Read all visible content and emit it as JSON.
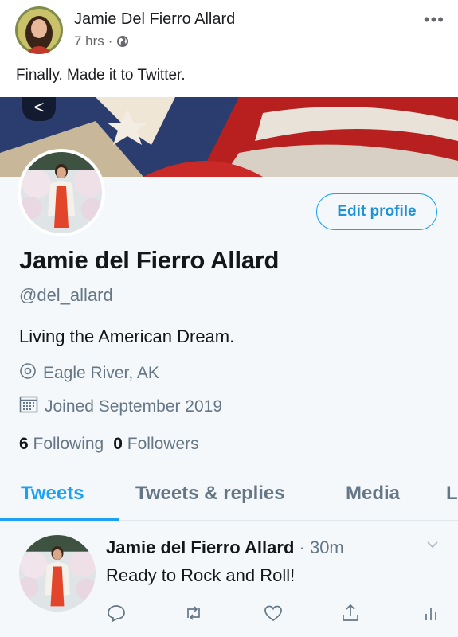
{
  "post": {
    "author": "Jamie Del Fierro Allard",
    "time": "7 hrs",
    "separator": "·",
    "text": "Finally. Made it to Twitter.",
    "more": "•••"
  },
  "twitter": {
    "back": "<",
    "edit_profile": "Edit profile",
    "name": "Jamie del Fierro Allard",
    "handle": "@del_allard",
    "bio": "Living the American Dream.",
    "location": "Eagle River, AK",
    "joined": "Joined September 2019",
    "following_count": "6",
    "following_label": "Following",
    "followers_count": "0",
    "followers_label": "Followers",
    "tabs": [
      {
        "label": "Tweets"
      },
      {
        "label": "Tweets & replies"
      },
      {
        "label": "Media"
      },
      {
        "label": "L"
      }
    ],
    "tweet": {
      "name": "Jamie del Fierro Allard",
      "time": "· 30m",
      "text": "Ready to Rock and Roll!"
    }
  },
  "colors": {
    "twitter_blue": "#1da1f2",
    "secondary_text": "#657786",
    "background": "#f5f8fa"
  },
  "icons": [
    "globe-icon",
    "more-icon",
    "location-pin-icon",
    "calendar-icon",
    "reply-icon",
    "retweet-icon",
    "like-icon",
    "share-icon",
    "analytics-icon",
    "chevron-down-icon"
  ]
}
